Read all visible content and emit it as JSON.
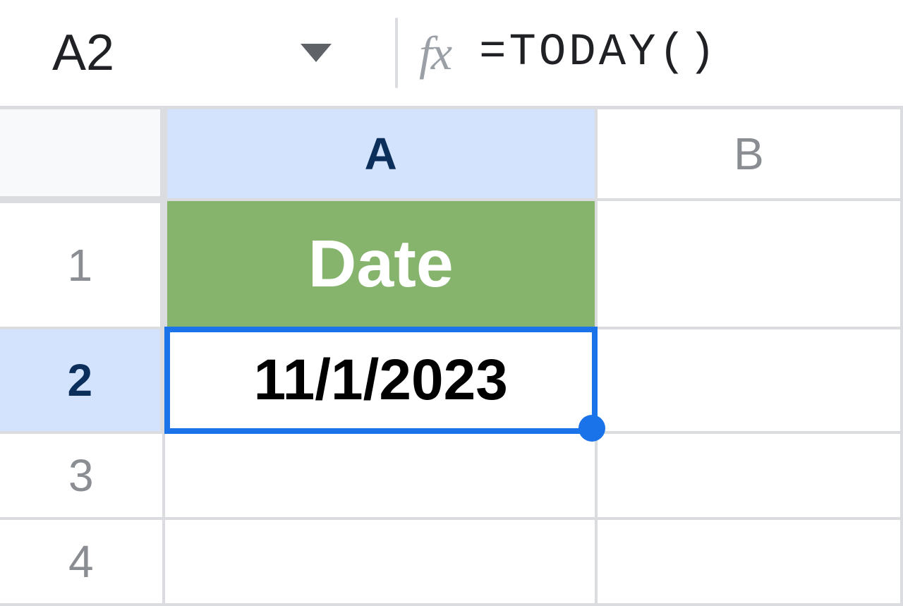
{
  "formula_bar": {
    "name_box": "A2",
    "fx_label": "fx",
    "formula": "=TODAY()"
  },
  "columns": {
    "A": "A",
    "B": "B"
  },
  "rows": {
    "r1": "1",
    "r2": "2",
    "r3": "3",
    "r4": "4"
  },
  "cells": {
    "A1": "Date",
    "A2": "11/1/2023",
    "B1": "",
    "B2": "",
    "A3": "",
    "B3": "",
    "A4": "",
    "B4": ""
  },
  "selection": {
    "active_cell": "A2"
  },
  "colors": {
    "header_green": "#86b46d",
    "selection_blue": "#1a73e8",
    "highlight_blue": "#d3e3fd"
  }
}
